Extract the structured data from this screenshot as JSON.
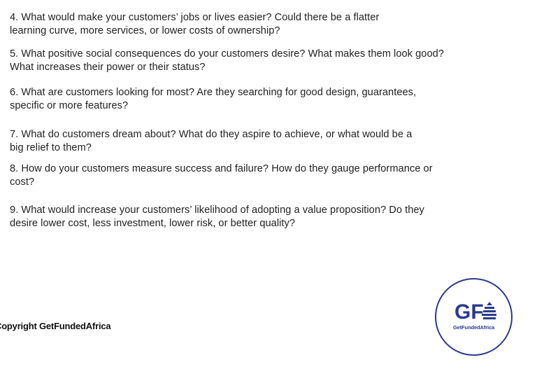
{
  "questions": [
    {
      "lines": [
        "4. What would make your customers’ jobs or lives easier? Could there be a flatter",
        "learning curve, more services, or lower costs of ownership?"
      ]
    },
    {
      "lines": [
        "5. What positive social consequences do your customers desire? What makes them look good?",
        "What increases their power or their status?"
      ]
    },
    {
      "lines": [
        "6. What are customers looking for most? Are they searching for good design, guarantees,",
        "specific or more features?"
      ]
    },
    {
      "lines": [
        "7. What do customers dream about? What do they aspire to achieve, or what would be a",
        "big relief to them?"
      ]
    },
    {
      "lines": [
        "8. How do your customers measure success and failure? How do they gauge performance or",
        "cost?"
      ]
    },
    {
      "lines": [
        "9. What would increase your customers’ likelihood of adopting a value proposition? Do they",
        "desire lower cost, less investment, lower risk, or better quality?"
      ]
    }
  ],
  "footer": {
    "copyright": "Copyright GetFundedAfrica"
  },
  "logo": {
    "initials": "GF",
    "name": "GetFundedAfrica",
    "color": "#2b3a8c"
  }
}
